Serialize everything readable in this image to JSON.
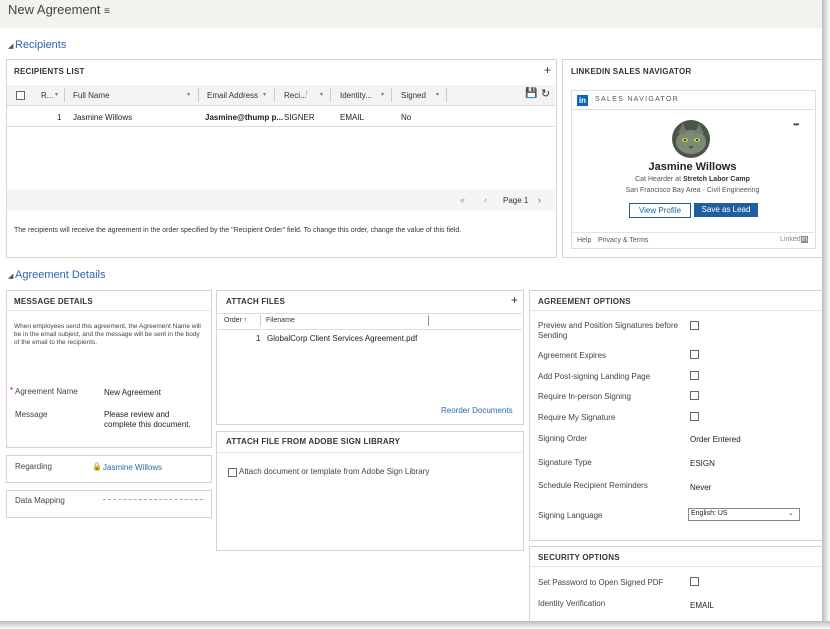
{
  "header": {
    "title": "New Agreement"
  },
  "sections": {
    "recipients": "Recipients",
    "agreement_details": "Agreement Details"
  },
  "recipients_list": {
    "title": "RECIPIENTS LIST",
    "add": "+",
    "columns": [
      "R...",
      "Full Name",
      "Email Address",
      "Reci...",
      "Identity...",
      "Signed"
    ],
    "row": {
      "order": "1",
      "name": "Jasmine Willows",
      "email": "Jasmine@thump p...",
      "role": "SIGNER",
      "identity": "EMAIL",
      "signed": "No"
    },
    "pager": {
      "first": "«",
      "prev": "‹",
      "page": "Page 1",
      "next": "›"
    },
    "note": "The recipients will receive the agreement in the order specified by the \"Recipient Order\" field. To change this order, change the value of this field."
  },
  "linkedin": {
    "panel_title": "LINKEDIN SALES NAVIGATOR",
    "brand": "in",
    "brand_text": "SALES NAVIGATOR",
    "more": "•••",
    "name": "Jasmine Willows",
    "title_prefix": "Cat Hearder at ",
    "company": "Stretch Labor Camp",
    "location": "San Francisco Bay Area · Civil Engineering",
    "view_profile": "View Profile",
    "save_lead": "Save as Lead",
    "help": "Help",
    "privacy": "Privacy & Terms",
    "footer_brand": "Linked",
    "footer_in": "in"
  },
  "message_details": {
    "title": "MESSAGE DETAILS",
    "info": "When employees send this agreement, the Agreement Name will be in the email subject, and the message will be sent in the body of the email to the recipients.",
    "required": "*",
    "name_label": "Agreement Name",
    "name_value": "New Agreement",
    "message_label": "Message",
    "message_value": "Please review and complete this document."
  },
  "regarding": {
    "label": "Regarding",
    "value": "Jasmine Willows"
  },
  "data_mapping": {
    "label": "Data Mapping"
  },
  "attach_files": {
    "title": "ATTACH FILES",
    "add": "+",
    "col_order": "Order ↑",
    "col_filename": "Filename",
    "row_order": "1",
    "row_file": "GlobalCorp Client Services Agreement.pdf",
    "reorder": "Reorder Documents"
  },
  "adobe_library": {
    "title": "ATTACH FILE FROM ADOBE SIGN LIBRARY",
    "option": "Attach document or template from Adobe Sign Library"
  },
  "agreement_options": {
    "title": "AGREEMENT OPTIONS",
    "checks": [
      "Preview and Position Signatures before Sending",
      "Agreement Expires",
      "Add Post-signing Landing Page",
      "Require In-person Signing",
      "Require My Signature"
    ],
    "signing_order_label": "Signing Order",
    "signing_order_value": "Order Entered",
    "signature_type_label": "Signature Type",
    "signature_type_value": "ESIGN",
    "reminders_label": "Schedule Recipient Reminders",
    "reminders_value": "Never",
    "language_label": "Signing Language",
    "language_value": "English: US"
  },
  "security_options": {
    "title": "SECURITY OPTIONS",
    "password_label": "Set Password to Open Signed PDF",
    "identity_label": "Identity Verification",
    "identity_value": "EMAIL"
  },
  "colors": {
    "link": "#2b66b3",
    "button": "#1f5f9e",
    "linkedin": "#0a66c2"
  }
}
